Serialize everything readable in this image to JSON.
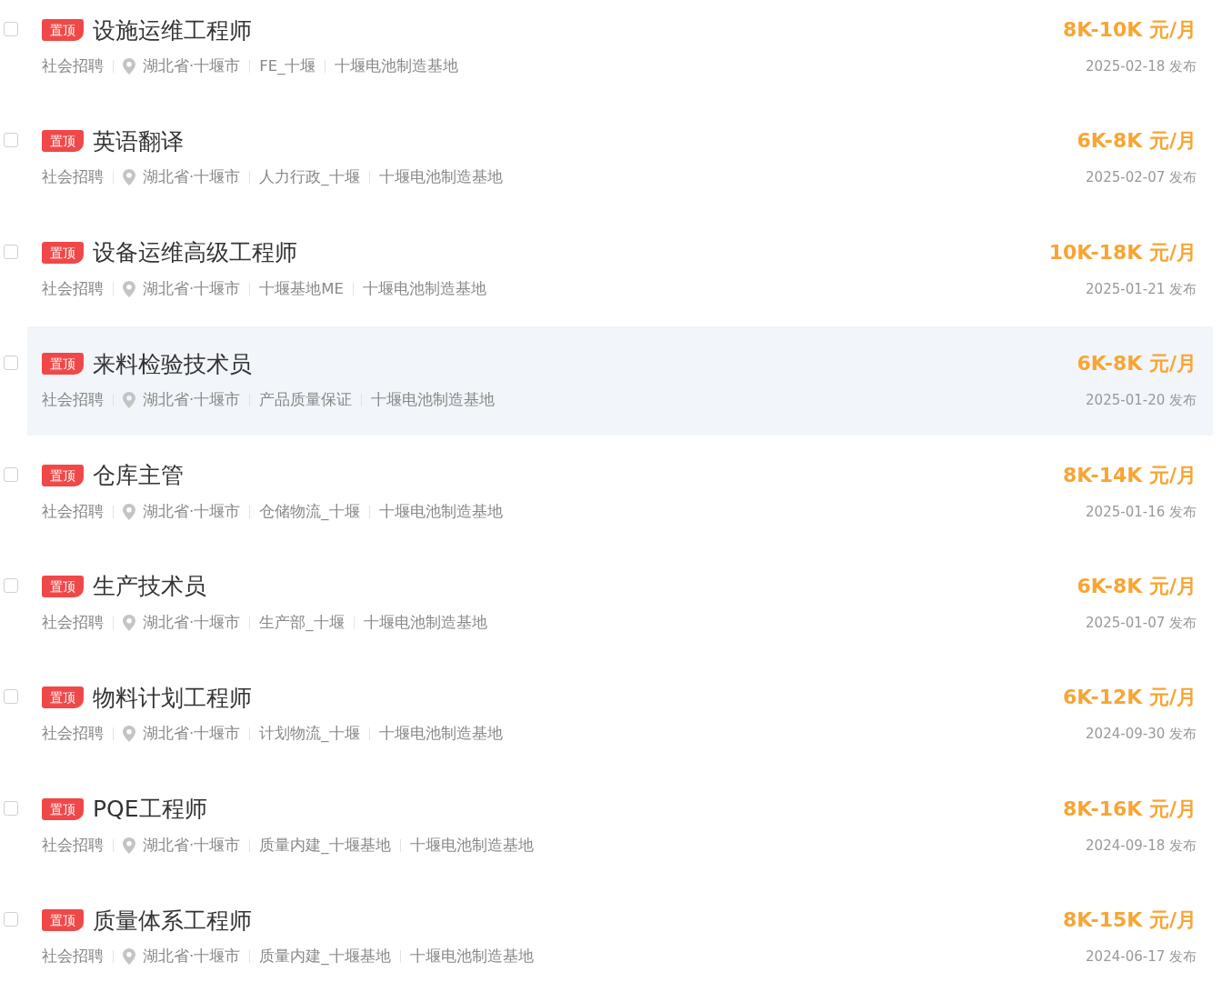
{
  "jobs": [
    {
      "checked": false,
      "highlighted": false,
      "badge": "置顶",
      "title": "设施运维工程师",
      "type": "社会招聘",
      "location": "湖北省·十堰市",
      "department": "FE_十堰",
      "site": "十堰电池制造基地",
      "salary": "8K-10K 元/月",
      "date": "2025-02-18 发布"
    },
    {
      "checked": false,
      "highlighted": false,
      "badge": "置顶",
      "title": "英语翻译",
      "type": "社会招聘",
      "location": "湖北省·十堰市",
      "department": "人力行政_十堰",
      "site": "十堰电池制造基地",
      "salary": "6K-8K 元/月",
      "date": "2025-02-07 发布"
    },
    {
      "checked": false,
      "highlighted": false,
      "badge": "置顶",
      "title": "设备运维高级工程师",
      "type": "社会招聘",
      "location": "湖北省·十堰市",
      "department": "十堰基地ME",
      "site": "十堰电池制造基地",
      "salary": "10K-18K 元/月",
      "date": "2025-01-21 发布"
    },
    {
      "checked": false,
      "highlighted": true,
      "badge": "置顶",
      "title": "来料检验技术员",
      "type": "社会招聘",
      "location": "湖北省·十堰市",
      "department": "产品质量保证",
      "site": "十堰电池制造基地",
      "salary": "6K-8K 元/月",
      "date": "2025-01-20 发布"
    },
    {
      "checked": false,
      "highlighted": false,
      "badge": "置顶",
      "title": "仓库主管",
      "type": "社会招聘",
      "location": "湖北省·十堰市",
      "department": "仓储物流_十堰",
      "site": "十堰电池制造基地",
      "salary": "8K-14K 元/月",
      "date": "2025-01-16 发布"
    },
    {
      "checked": false,
      "highlighted": false,
      "badge": "置顶",
      "title": "生产技术员",
      "type": "社会招聘",
      "location": "湖北省·十堰市",
      "department": "生产部_十堰",
      "site": "十堰电池制造基地",
      "salary": "6K-8K 元/月",
      "date": "2025-01-07 发布"
    },
    {
      "checked": false,
      "highlighted": false,
      "badge": "置顶",
      "title": "物料计划工程师",
      "type": "社会招聘",
      "location": "湖北省·十堰市",
      "department": "计划物流_十堰",
      "site": "十堰电池制造基地",
      "salary": "6K-12K 元/月",
      "date": "2024-09-30 发布"
    },
    {
      "checked": false,
      "highlighted": false,
      "badge": "置顶",
      "title": "PQE工程师",
      "type": "社会招聘",
      "location": "湖北省·十堰市",
      "department": "质量内建_十堰基地",
      "site": "十堰电池制造基地",
      "salary": "8K-16K 元/月",
      "date": "2024-09-18 发布"
    },
    {
      "checked": false,
      "highlighted": false,
      "badge": "置顶",
      "title": "质量体系工程师",
      "type": "社会招聘",
      "location": "湖北省·十堰市",
      "department": "质量内建_十堰基地",
      "site": "十堰电池制造基地",
      "salary": "8K-15K 元/月",
      "date": "2024-06-17 发布"
    }
  ]
}
